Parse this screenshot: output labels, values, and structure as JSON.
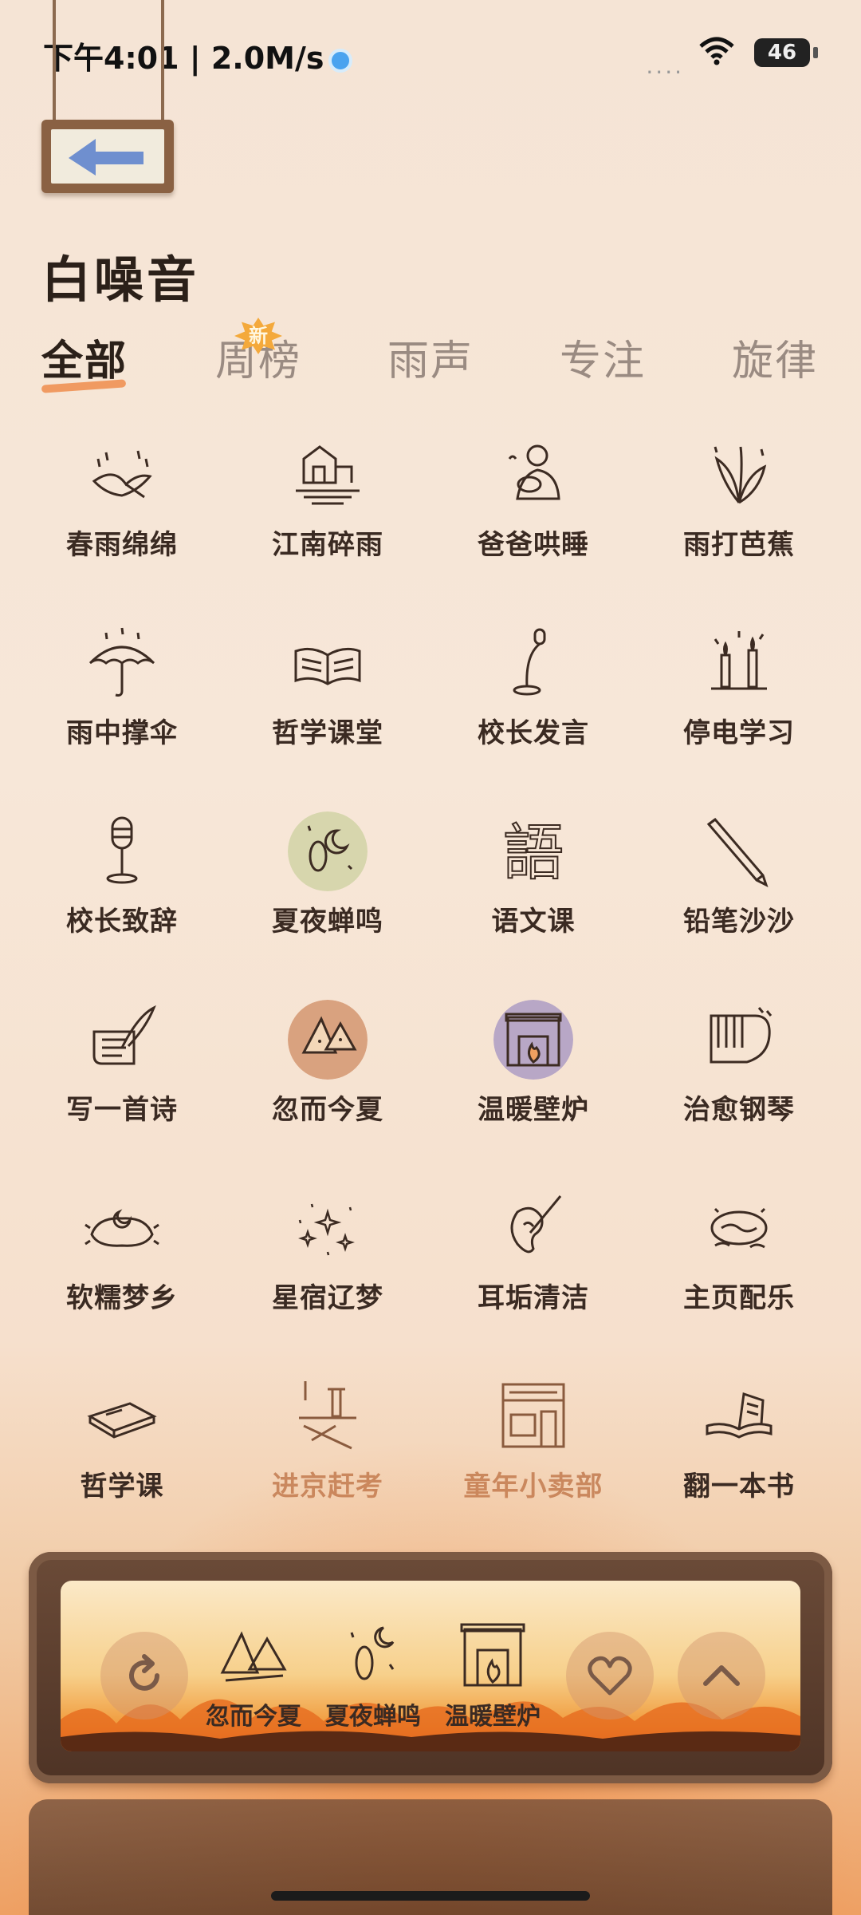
{
  "status_bar": {
    "time": "下午4:01 | 2.0M/s",
    "signal_dots": "....",
    "battery": "46"
  },
  "page": {
    "title": "白噪音"
  },
  "tabs": [
    {
      "label": "全部",
      "active": true
    },
    {
      "label": "周榜",
      "active": false
    },
    {
      "label": "雨声",
      "active": false
    },
    {
      "label": "专注",
      "active": false
    },
    {
      "label": "旋律",
      "active": false
    }
  ],
  "new_badge": "新",
  "sounds": [
    {
      "label": "春雨绵绵",
      "icon": "swallow-rain-icon"
    },
    {
      "label": "江南碎雨",
      "icon": "riverside-house-icon"
    },
    {
      "label": "爸爸哄睡",
      "icon": "father-baby-icon"
    },
    {
      "label": "雨打芭蕉",
      "icon": "banana-leaf-icon"
    },
    {
      "label": "雨中撑伞",
      "icon": "umbrella-icon"
    },
    {
      "label": "哲学课堂",
      "icon": "open-book-icon"
    },
    {
      "label": "校长发言",
      "icon": "desk-microphone-icon"
    },
    {
      "label": "停电学习",
      "icon": "candles-icon"
    },
    {
      "label": "校长致辞",
      "icon": "stand-microphone-icon"
    },
    {
      "label": "夏夜蝉鸣",
      "icon": "cicada-moon-icon"
    },
    {
      "label": "语文课",
      "icon": "chinese-character-icon"
    },
    {
      "label": "铅笔沙沙",
      "icon": "pencil-icon"
    },
    {
      "label": "写一首诗",
      "icon": "quill-scroll-icon"
    },
    {
      "label": "忽而今夏",
      "icon": "watermelon-icon"
    },
    {
      "label": "温暖壁炉",
      "icon": "fireplace-icon"
    },
    {
      "label": "治愈钢琴",
      "icon": "piano-icon"
    },
    {
      "label": "软糯梦乡",
      "icon": "pillow-moon-icon"
    },
    {
      "label": "星宿辽梦",
      "icon": "stars-icon"
    },
    {
      "label": "耳垢清洁",
      "icon": "ear-cleaning-icon"
    },
    {
      "label": "主页配乐",
      "icon": "vinyl-cloud-icon"
    },
    {
      "label": "哲学课",
      "icon": "closed-book-icon"
    },
    {
      "label": "进京赶考",
      "icon": "scholar-journey-icon"
    },
    {
      "label": "童年小卖部",
      "icon": "shop-icon"
    },
    {
      "label": "翻一本书",
      "icon": "flipping-book-icon"
    }
  ],
  "now_playing": [
    {
      "label": "忽而今夏",
      "icon": "watermelon-icon"
    },
    {
      "label": "夏夜蝉鸣",
      "icon": "cicada-moon-icon"
    },
    {
      "label": "温暖壁炉",
      "icon": "fireplace-icon"
    }
  ],
  "controls": {
    "replay_icon": "replay-icon",
    "favorite_icon": "heart-icon",
    "expand_icon": "chevron-up-icon"
  },
  "colors": {
    "accent": "#ee8d4c",
    "badge": "#f4a93b",
    "text": "#3a2a22"
  }
}
